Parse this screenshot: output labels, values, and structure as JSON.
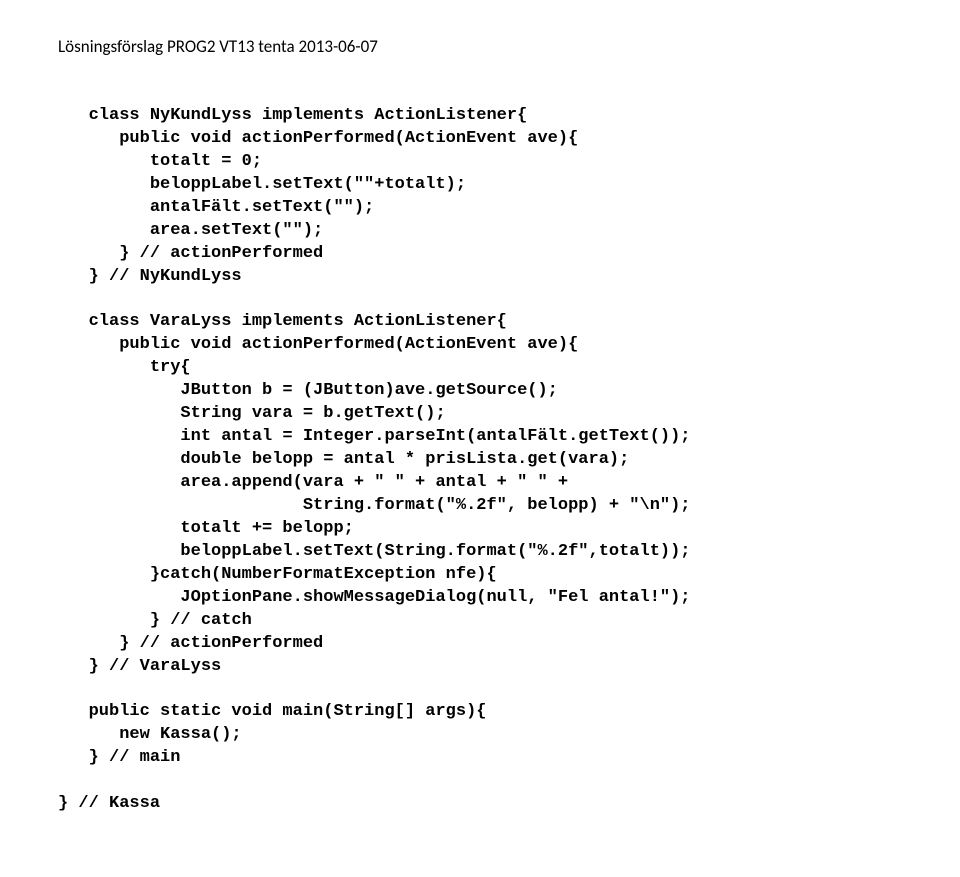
{
  "header": {
    "title": "Lösningsförslag PROG2 VT13 tenta 2013-06-07"
  },
  "code": {
    "block": "   class NyKundLyss implements ActionListener{\n      public void actionPerformed(ActionEvent ave){\n         totalt = 0;\n         beloppLabel.setText(\"\"+totalt);\n         antalFält.setText(\"\");\n         area.setText(\"\");\n      } // actionPerformed\n   } // NyKundLyss\n\n   class VaraLyss implements ActionListener{\n      public void actionPerformed(ActionEvent ave){\n         try{\n            JButton b = (JButton)ave.getSource();\n            String vara = b.getText();\n            int antal = Integer.parseInt(antalFält.getText());\n            double belopp = antal * prisLista.get(vara);\n            area.append(vara + \" \" + antal + \" \" +\n                        String.format(\"%.2f\", belopp) + \"\\n\");\n            totalt += belopp;\n            beloppLabel.setText(String.format(\"%.2f\",totalt));\n         }catch(NumberFormatException nfe){\n            JOptionPane.showMessageDialog(null, \"Fel antal!\");\n         } // catch\n      } // actionPerformed\n   } // VaraLyss\n\n   public static void main(String[] args){\n      new Kassa();\n   } // main\n\n} // Kassa"
  }
}
